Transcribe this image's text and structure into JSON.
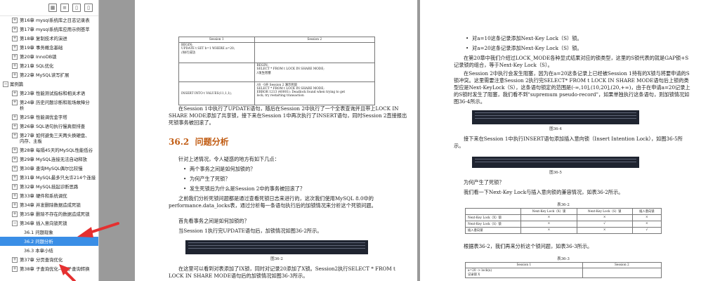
{
  "sidebar": {
    "toolbar_icons": [
      "grid-icon",
      "bookmark-list-icon",
      "bookmark-icon",
      "bookmark-alt-icon"
    ],
    "items": [
      {
        "label": "第16章  mysql系统库之日志记录表",
        "level": 1,
        "exp": "+"
      },
      {
        "label": "第17章  mysql系统库应用示例荟萃",
        "level": 1,
        "exp": "+"
      },
      {
        "label": "第18章  复制技术的演进",
        "level": 1,
        "exp": "+"
      },
      {
        "label": "第19章  事务概念基础",
        "level": 1,
        "exp": "+"
      },
      {
        "label": "第20章  InnoDB锁",
        "level": 1,
        "exp": "+"
      },
      {
        "label": "第21章  SQL优化",
        "level": 1,
        "exp": "+"
      },
      {
        "label": "第22章  MySQL读写扩展",
        "level": 1,
        "exp": "+"
      },
      {
        "label": "案例篇",
        "level": 0,
        "exp": "-"
      },
      {
        "label": "第23章  性能测试指标和相关术语",
        "level": 1,
        "exp": "+"
      },
      {
        "label": "第24章  历史问题诊断和现场故障分析",
        "level": 1,
        "exp": "+",
        "wrap": true
      },
      {
        "label": "第25章  性能调优金字塔",
        "level": 1,
        "exp": "+"
      },
      {
        "label": "第26章  SQL语句执行慢真假排查",
        "level": 1,
        "exp": "+"
      },
      {
        "label": "第27章  如何避免三天两头换硬盘、内存、主板",
        "level": 1,
        "exp": "+",
        "wrap": true
      },
      {
        "label": "第28章  每隔45天的MySQL性能低谷",
        "level": 1,
        "exp": "+"
      },
      {
        "label": "第29章  MySQL连接无法自动释放",
        "level": 1,
        "exp": "+"
      },
      {
        "label": "第30章  查询MySQL偶尔比较慢",
        "level": 1,
        "exp": "+"
      },
      {
        "label": "第31章  MySQL最多只允许214个连接",
        "level": 1,
        "exp": "+"
      },
      {
        "label": "第32章  MySQL挂起诊断思路",
        "level": 1,
        "exp": "+"
      },
      {
        "label": "第33章  硬件和系统调优",
        "level": 1,
        "exp": "+"
      },
      {
        "label": "第34章  并发删除数据造成死锁",
        "level": 1,
        "exp": "+"
      },
      {
        "label": "第35章  删除不存在的数据造成死锁",
        "level": 1,
        "exp": "+"
      },
      {
        "label": "第36章  插入意向锁死锁",
        "level": 1,
        "exp": "-"
      },
      {
        "label": "36.1  问题现象",
        "level": 2
      },
      {
        "label": "36.2  问题分析",
        "level": 2,
        "active": true
      },
      {
        "label": "36.3  本章小结",
        "level": 2
      },
      {
        "label": "第37章  分页查询优化",
        "level": 1,
        "exp": "+"
      },
      {
        "label": "第38章  子查询优化——子查询转换",
        "level": 1,
        "exp": "+"
      }
    ]
  },
  "left_page": {
    "table_header": [
      "Session 1",
      "Session 2"
    ],
    "table_rows": [
      [
        "BEGIN;\nUPDATE t SET b=1 WHERE a=20;\n//执行成功",
        ""
      ],
      [
        "",
        "BEGIN;\nSELECT * FROM t LOCK IN SHARE MODE;\n//发生阻塞"
      ],
      [
        "INSERT INTO t VALUES(11,1,1);",
        "//8 · 0开 Session 2 演示死锁\nSELECT * FROM t LOCK IN SHARE MODE;\nERROR 1213 (40001): Deadlock found when trying to get\nlock; try restarting transaction"
      ]
    ],
    "para1": "在Session 1中执行了UPDATE语句，随后在Session 2中执行了一个全表查询并且带上LOCK IN SHARE MODE添加了共享锁，接下来在Session 1中再次执行了INSERT语句，同时Session 2直接报出死锁事务被回滚了。",
    "section_num": "36.2",
    "section_title": "问题分析",
    "para2": "针对上述情况，令人疑惑的地方有如下几点：",
    "bullets": [
      "两个事务之间是如何加锁的？",
      "为何产生了死锁？",
      "发生死锁后为什么是Session 2中的事务被回滚了？"
    ],
    "para3": "之前我们分析死锁问题都是通过查看死锁日志来进行的，这次我们使用MySQL 8.0中的performance.data_locks表，通过分析每一条语句执行后的加锁情况来分析这个死锁问题。",
    "para4": "首先看事务之间是如何加锁的？",
    "para5": "当Session 1执行完UPDATE语句后，加锁情况如图36-2所示。",
    "fig1": "图36-2",
    "para6": "在这里可以看到对表添加了IX锁，同时对记录20添加了X锁。Session2执行SELECT * FROM t LOCK IN SHARE MODE语句后的加锁情况如图36-3所示。"
  },
  "right_page": {
    "bullets": [
      "对a=10这条记录添加Next-Key Lock（S）锁。",
      "对a=20这条记录添加Next-Key Lock（S）锁。"
    ],
    "para1": "在第20章中我们介绍过LOCK_MODE各种显式结果对应的锁类型，这里的S锁代表的就是GAP锁+S记录锁的组合，等于Next-Key Lock（S）。",
    "para2": "在Session 2中执行会发生阻塞，因为在a=20这条记录上已经被Session 1持有的X锁与将要申请的S锁冲突。这里需要注意Session 2执行完SELECT* FROM t LOCK IN SHARE MODE语句后上锁的类型应是Next-KeyLock（S），这条语句锁定的范围是(-∞,10],(10,20],(20,+∞)，由于在申请a=20记录上的S锁时发生了阻塞，我们看不到\"supremum pseudo-record\"，如果单独执行这条语句，则加锁情况如图36-4所示。",
    "fig4": "图36-4",
    "para3": "接下来在Session 1中执行INSERT语句添加插入意向锁（Insert Intention Lock），如图36-5所示。",
    "fig5": "图36-5",
    "para4": "为何产生了死锁？",
    "para5": "我们看一下Next-Key Lock与插入意向锁的兼容情况，如表36-2所示。",
    "tab2_title": "表36-2",
    "tab2_header": [
      "",
      "Next-Key Lock（X）锁",
      "Next-Key Lock（S）锁",
      "插入意向锁"
    ],
    "tab2_rows": [
      [
        "Next-Key Lock（X）锁",
        "×",
        "×",
        "×"
      ],
      [
        "Next-Key Lock（S）锁",
        "×",
        "√",
        "×"
      ],
      [
        "插入意向锁",
        "×",
        "×",
        "√"
      ]
    ],
    "para6": "根据表36-2，我们再来分析这个锁问题，如表36-3所示。",
    "tab3_title": "表36-3",
    "tab3_header": [
      "Session 1",
      "Session 2"
    ],
    "tab3_rows": [
      [
        "a=20 -> lock(x)\n记录锁 X",
        ""
      ]
    ]
  },
  "colors": {
    "accent": "#3a8ee6",
    "section": "#c05a10",
    "arrow": "#e53030"
  }
}
